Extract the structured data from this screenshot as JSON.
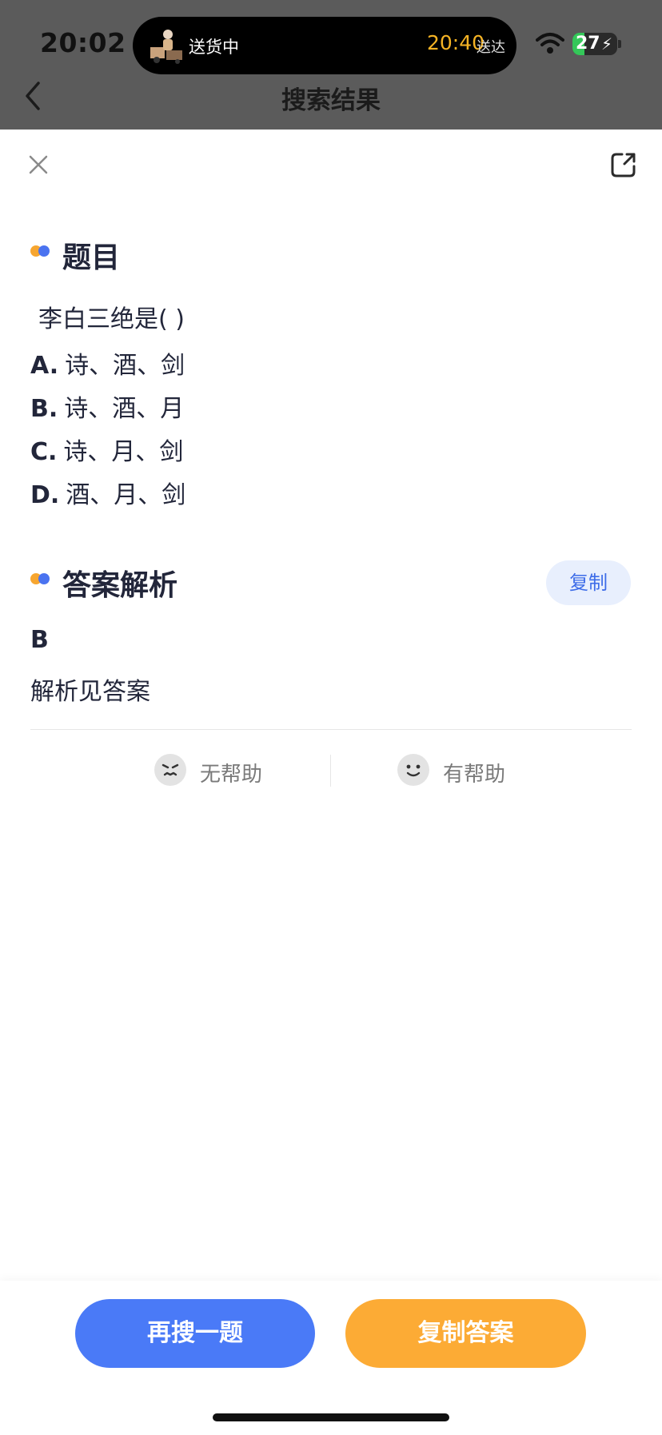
{
  "status_bar": {
    "time": "20:02",
    "live_activity": {
      "status": "送货中",
      "eta_time": "20:40",
      "eta_suffix": "送达"
    },
    "battery_level": "27"
  },
  "nav": {
    "title": "搜索结果"
  },
  "question_section": {
    "title": "题目",
    "question": "李白三绝是( )",
    "options": [
      {
        "letter": "A.",
        "text": "诗、酒、剑"
      },
      {
        "letter": "B.",
        "text": "诗、酒、月"
      },
      {
        "letter": "C.",
        "text": "诗、月、剑"
      },
      {
        "letter": "D.",
        "text": "酒、月、剑"
      }
    ]
  },
  "answer_section": {
    "title": "答案解析",
    "copy_label": "复制",
    "answer": "B",
    "analysis": "解析见答案"
  },
  "feedback": {
    "not_helpful": "无帮助",
    "helpful": "有帮助"
  },
  "actions": {
    "search_again": "再搜一题",
    "copy_answer": "复制答案"
  },
  "colors": {
    "accent_blue": "#4a7af7",
    "accent_orange": "#fcab35",
    "eta_yellow": "#f5b324",
    "battery_green": "#34c759"
  }
}
